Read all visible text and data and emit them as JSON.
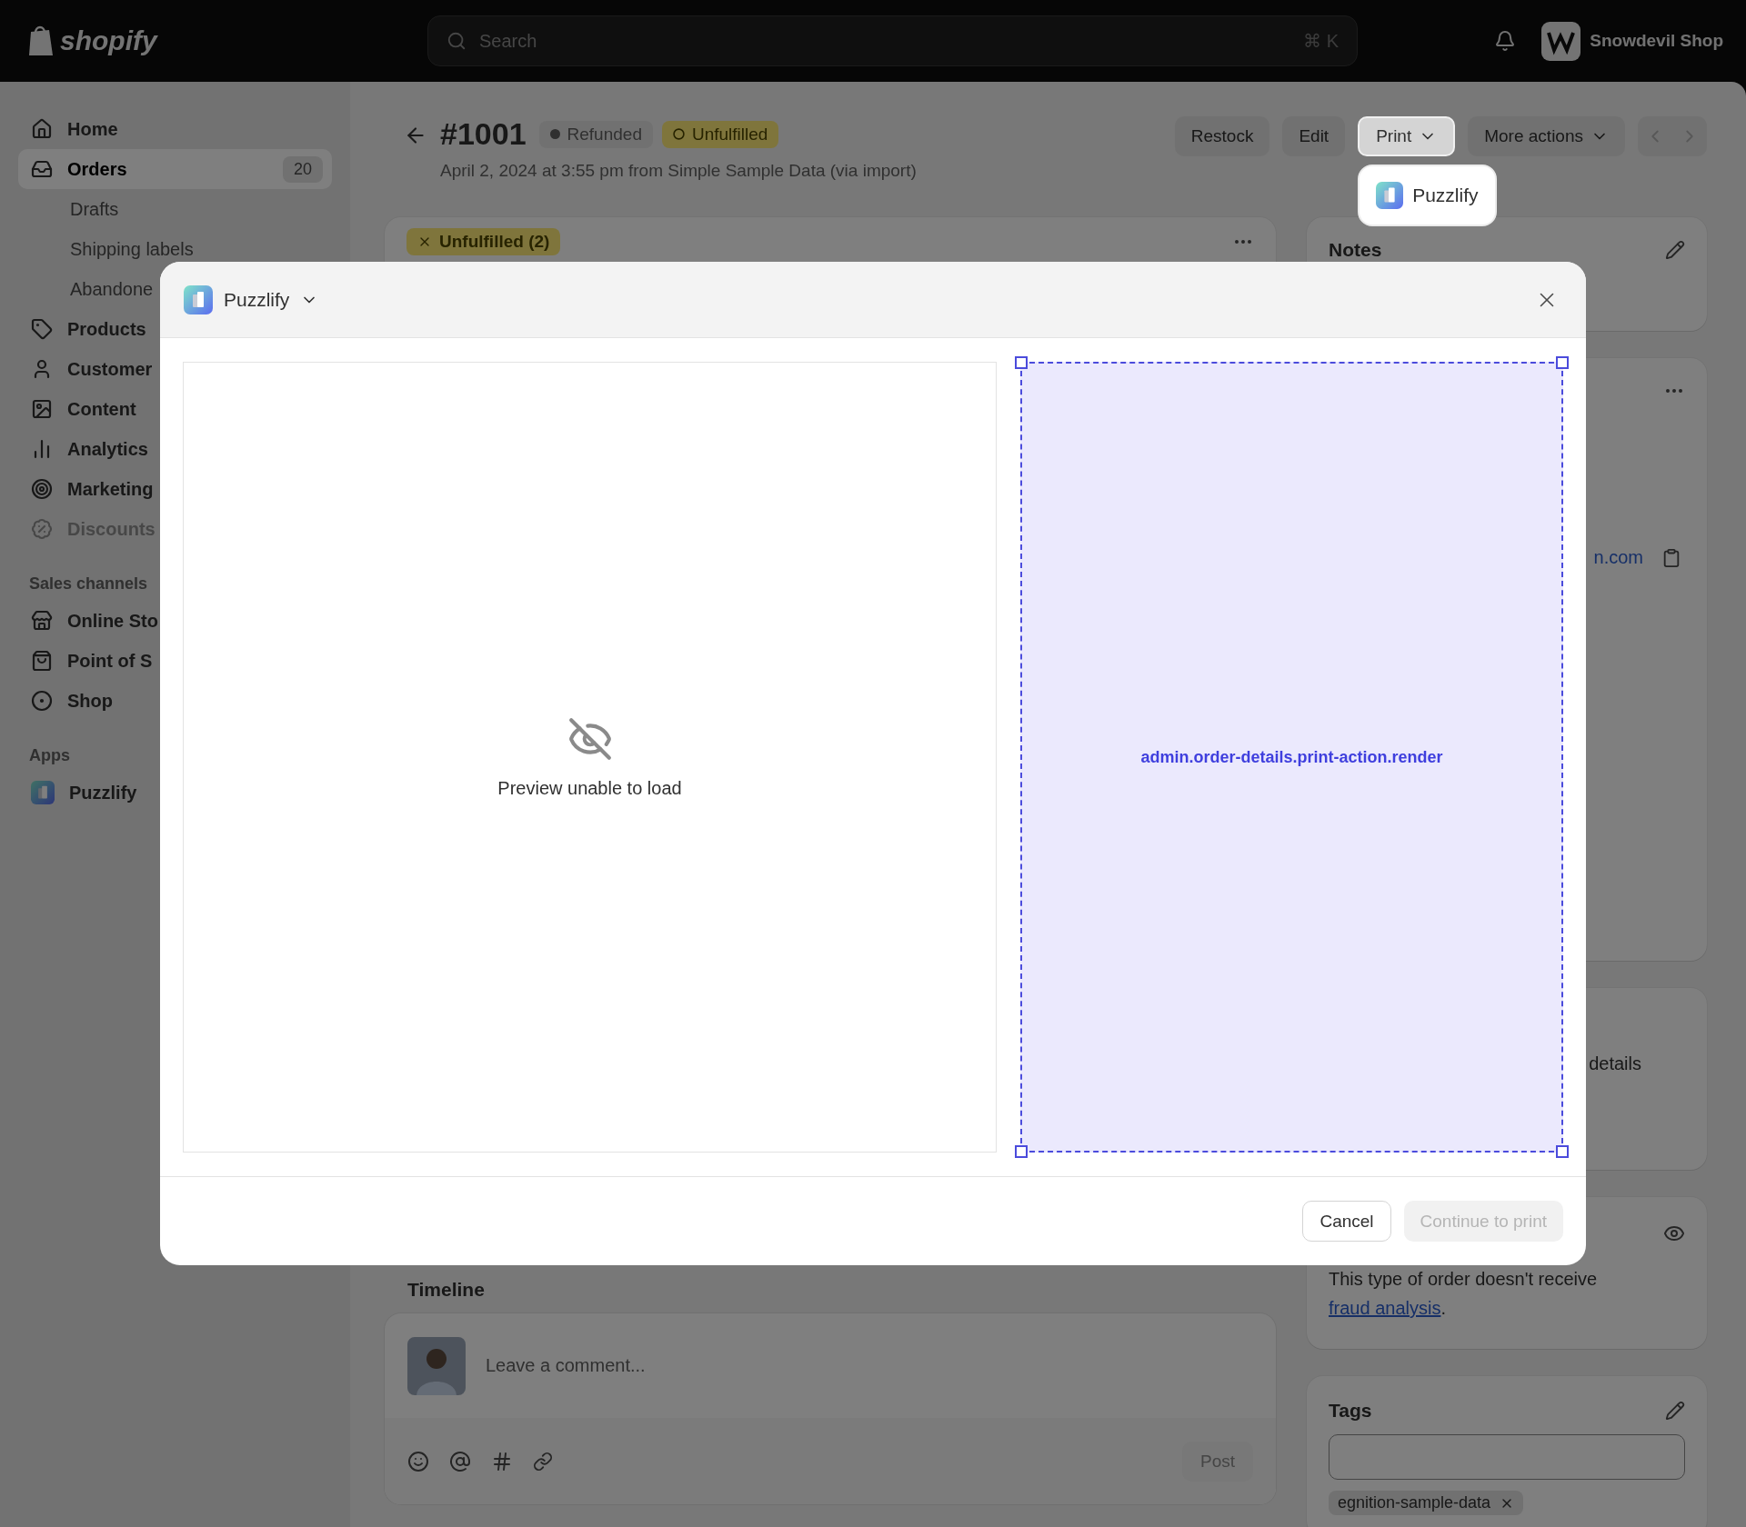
{
  "topbar": {
    "logo": "shopify",
    "search": {
      "placeholder": "Search",
      "shortcut": "⌘ K"
    },
    "store": {
      "name": "Snowdevil Shop"
    }
  },
  "sidebar": {
    "sections": [
      {
        "items": [
          {
            "label": "Home",
            "selected": false,
            "disabled": false
          },
          {
            "label": "Orders",
            "selected": true,
            "disabled": false,
            "badge": "20",
            "children": [
              {
                "label": "Drafts",
                "selected": false
              },
              {
                "label": "Shipping labels",
                "selected": false
              },
              {
                "label": "Abandone",
                "selected": false
              }
            ]
          },
          {
            "label": "Products",
            "selected": false,
            "disabled": false
          },
          {
            "label": "Customer",
            "selected": false,
            "disabled": false
          },
          {
            "label": "Content",
            "selected": false,
            "disabled": false
          },
          {
            "label": "Analytics",
            "selected": false,
            "disabled": false
          },
          {
            "label": "Marketing",
            "selected": false,
            "disabled": false
          },
          {
            "label": "Discounts",
            "selected": false,
            "disabled": true
          }
        ]
      },
      {
        "title": "Sales channels",
        "items": [
          {
            "label": "Online Sto",
            "selected": false,
            "disabled": false
          },
          {
            "label": "Point of S",
            "selected": false,
            "disabled": false
          },
          {
            "label": "Shop",
            "selected": false,
            "disabled": false
          }
        ]
      },
      {
        "title": "Apps",
        "items": [
          {
            "label": "Puzzlify",
            "selected": false,
            "disabled": false
          }
        ]
      }
    ]
  },
  "order": {
    "number": "#1001",
    "badges": [
      {
        "label": "Refunded",
        "kind": "refunded"
      },
      {
        "label": "Unfulfilled",
        "kind": "unfulfilled"
      }
    ],
    "subtitle": "April 2, 2024 at 3:55 pm from Simple Sample Data (via import)",
    "actions": [
      {
        "label": "Restock",
        "dropdown": false,
        "open": false
      },
      {
        "label": "Edit",
        "dropdown": false,
        "open": false
      },
      {
        "label": "Print",
        "dropdown": true,
        "open": true
      },
      {
        "label": "More actions",
        "dropdown": true,
        "open": false
      }
    ]
  },
  "print_menu": {
    "items": [
      {
        "label": "Puzzlify"
      }
    ]
  },
  "fulfillment_card": {
    "badge": "Unfulfilled (2)"
  },
  "notes_card": {
    "title": "Notes"
  },
  "customer_card": {
    "email": "n.com"
  },
  "address_card": {
    "text": "details"
  },
  "risk_card": {
    "text": "This type of order doesn't receive ",
    "link": "fraud analysis",
    "after": "."
  },
  "tags_card": {
    "title": "Tags",
    "tags": [
      {
        "label": "egnition-sample-data"
      }
    ]
  },
  "timeline": {
    "title": "Timeline",
    "comment_placeholder": "Leave a comment...",
    "post": {
      "label": "Post",
      "disabled": true
    }
  },
  "modal": {
    "app": "Puzzlify",
    "preview_message": "Preview unable to load",
    "target": "admin.order-details.print-action.render",
    "buttons": [
      {
        "label": "Cancel",
        "kind": "secondary",
        "disabled": false
      },
      {
        "label": "Continue to print",
        "kind": "primary",
        "disabled": true
      }
    ]
  }
}
